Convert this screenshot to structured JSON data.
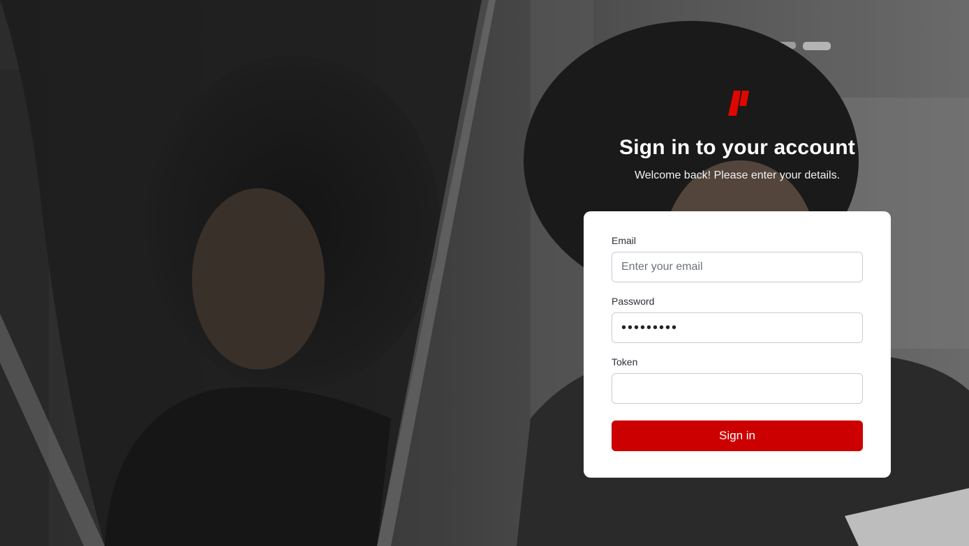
{
  "brand": {
    "accent": "#cc0000",
    "logo_icon": "brand-logo-icon"
  },
  "header": {
    "title": "Sign in to your account",
    "subtitle": "Welcome back! Please enter your details."
  },
  "form": {
    "email": {
      "label": "Email",
      "placeholder": "Enter your email",
      "value": ""
    },
    "password": {
      "label": "Password",
      "value": "•••••••••"
    },
    "token": {
      "label": "Token",
      "value": ""
    },
    "submit_label": "Sign in"
  }
}
